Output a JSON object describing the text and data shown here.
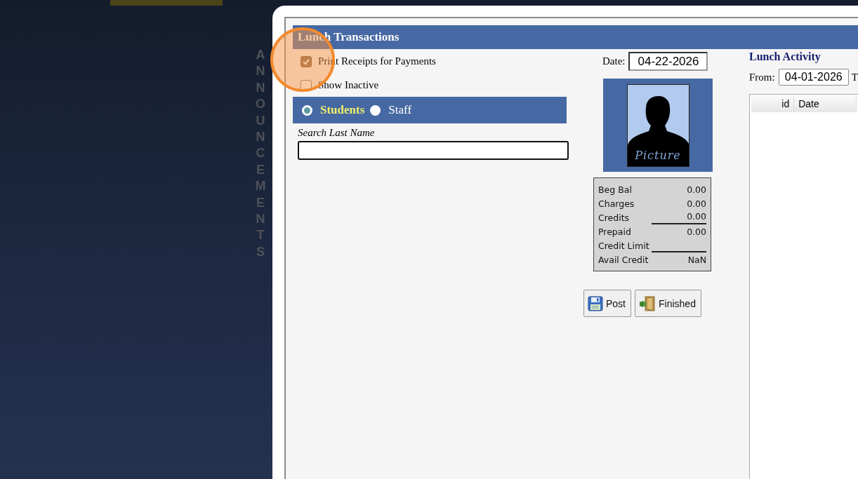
{
  "sidebar": {
    "label": "ANNOUNCEMENTS"
  },
  "dialog": {
    "title": "Lunch Transactions"
  },
  "options": [
    {
      "label": "Print Receipts for Payments",
      "checked": true
    },
    {
      "label": "Show Inactive",
      "checked": false
    }
  ],
  "person_type": [
    {
      "label": "Students",
      "selected": true
    },
    {
      "label": "Staff",
      "selected": false
    }
  ],
  "search": {
    "label": "Search Last Name"
  },
  "date": {
    "label": "Date:",
    "value": "04-22-2026"
  },
  "photo": {
    "caption": "Picture"
  },
  "balances": [
    {
      "label": "Beg Bal",
      "value": "0.00",
      "ruled": false
    },
    {
      "label": "Charges",
      "value": "0.00",
      "ruled": false
    },
    {
      "label": "Credits",
      "value": "0.00",
      "ruled": true
    },
    {
      "label": "Prepaid",
      "value": "0.00",
      "ruled": false
    },
    {
      "label": "Credit Limit",
      "ruled": true
    },
    {
      "label": "Avail Credit",
      "value": "NaN",
      "ruled": false
    }
  ],
  "buttons": [
    {
      "kind": "save",
      "label": "Post"
    },
    {
      "kind": "exit",
      "label": "Finished"
    }
  ],
  "activity": {
    "title": "Lunch Activity",
    "from_label": "From:",
    "from_value": "04-01-2026",
    "to_label": "T",
    "columns": [
      "id",
      "Date"
    ]
  }
}
